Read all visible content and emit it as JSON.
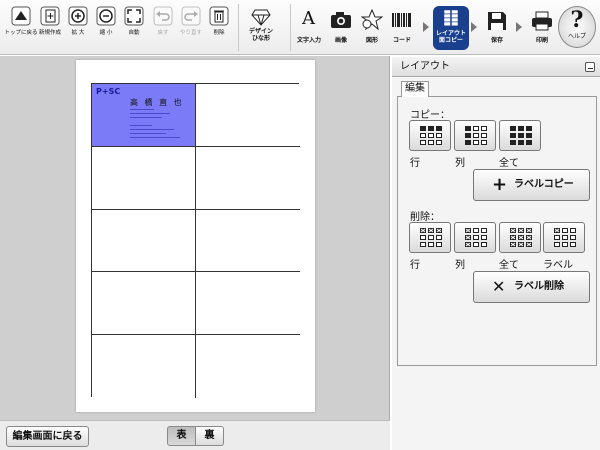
{
  "toolbar": {
    "buttons": [
      {
        "label": "トップに戻る",
        "icon": "up-triangle-icon"
      },
      {
        "label": "新規作成",
        "icon": "new-document-icon"
      },
      {
        "label": "拡 大",
        "icon": "zoom-in-icon"
      },
      {
        "label": "縮 小",
        "icon": "zoom-out-icon"
      },
      {
        "label": "自動",
        "icon": "fit-screen-icon"
      },
      {
        "label": "戻す",
        "icon": "undo-icon",
        "disabled": true
      },
      {
        "label": "やり直す",
        "icon": "redo-icon",
        "disabled": true
      },
      {
        "label": "削除",
        "icon": "trash-icon"
      }
    ],
    "design_label": "デザイン\nひな形",
    "tools": [
      {
        "label": "文字入力",
        "icon": "text-icon"
      },
      {
        "label": "画像",
        "icon": "camera-icon"
      },
      {
        "label": "図形",
        "icon": "shapes-icon"
      },
      {
        "label": "コード",
        "icon": "barcode-icon"
      }
    ],
    "layout_label_1": "レイアウト",
    "layout_label_2": "面コピー",
    "save_label": "保存",
    "print_label": "印刷",
    "help_symbol": "?",
    "help_label": "ヘルプ"
  },
  "card": {
    "logo": "P+SC",
    "name": "高 橋  直 也"
  },
  "bottom": {
    "back_label": "編集画面に戻る",
    "front_label": "表",
    "back_side_label": "裏"
  },
  "panel": {
    "title": "レイアウト",
    "tab": "編集",
    "copy_label": "コピー：",
    "copy_buttons": [
      "行",
      "列",
      "全て"
    ],
    "copy_action": "ラベルコピー",
    "delete_label": "削除：",
    "delete_buttons": [
      "行",
      "列",
      "全て",
      "ラベル"
    ],
    "delete_action": "ラベル削除"
  },
  "colors": {
    "selected_label": "#7b7bf7",
    "active_tool": "#1b3f8f"
  }
}
